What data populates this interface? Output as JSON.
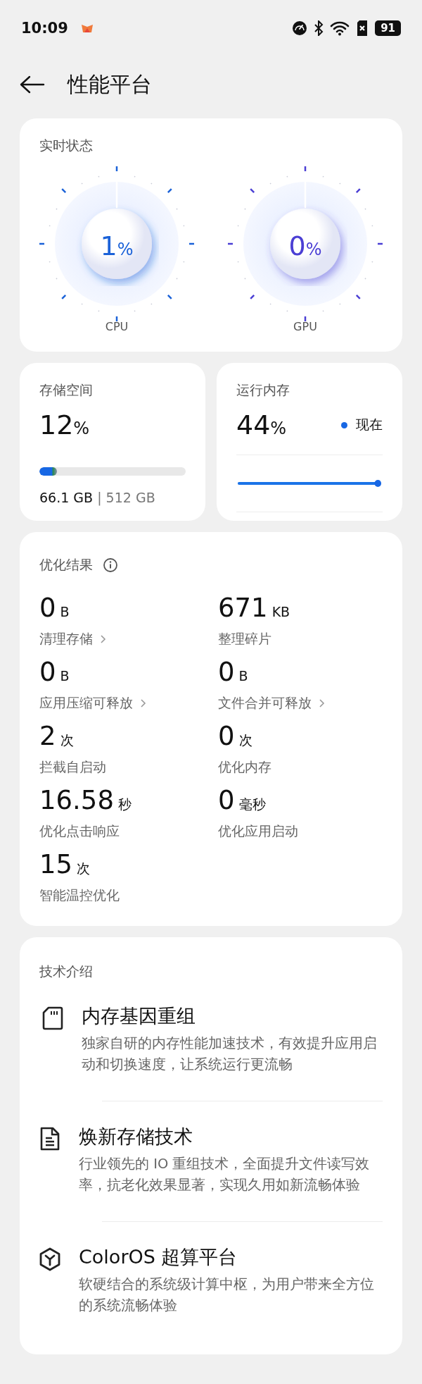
{
  "status_bar": {
    "time": "10:09",
    "battery": "91"
  },
  "header": {
    "title": "性能平台"
  },
  "realtime": {
    "title": "实时状态",
    "gauges": [
      {
        "label": "CPU",
        "value": "1",
        "unit": "%",
        "color": "#1b62d8"
      },
      {
        "label": "GPU",
        "value": "0",
        "unit": "%",
        "color": "#4b3fd4"
      }
    ]
  },
  "storage": {
    "title": "存储空间",
    "value": "12",
    "unit": "%",
    "level": 0.12,
    "used": "66.1 GB",
    "separator": "|",
    "total": "512 GB"
  },
  "memory": {
    "title": "运行内存",
    "value": "44",
    "unit": "%",
    "legend": "现在"
  },
  "optimization": {
    "title": "优化结果",
    "items": [
      {
        "value": "0",
        "unit": "B",
        "label": "清理存储",
        "chevron": true
      },
      {
        "value": "671",
        "unit": "KB",
        "label": "整理碎片",
        "chevron": false
      },
      {
        "value": "0",
        "unit": "B",
        "label": "应用压缩可释放",
        "chevron": true
      },
      {
        "value": "0",
        "unit": "B",
        "label": "文件合并可释放",
        "chevron": true
      },
      {
        "value": "2",
        "unit": "次",
        "label": "拦截自启动",
        "chevron": false
      },
      {
        "value": "0",
        "unit": "次",
        "label": "优化内存",
        "chevron": false
      },
      {
        "value": "16.58",
        "unit": "秒",
        "label": "优化点击响应",
        "chevron": false
      },
      {
        "value": "0",
        "unit": "毫秒",
        "label": "优化应用启动",
        "chevron": false
      },
      {
        "value": "15",
        "unit": "次",
        "label": "智能温控优化",
        "chevron": false
      }
    ]
  },
  "tech": {
    "title": "技术介绍",
    "items": [
      {
        "kind": "card",
        "title": "内存基因重组",
        "description": "独家自研的内存性能加速技术，有效提升应用启动和切换速度，让系统运行更流畅"
      },
      {
        "kind": "document",
        "title": "焕新存储技术",
        "description": "行业领先的 IO 重组技术，全面提升文件读写效率，抗老化效果显著，实现久用如新流畅体验"
      },
      {
        "kind": "cube",
        "title": "ColorOS 超算平台",
        "description": "软硬结合的系统级计算中枢，为用户带来全方位的系统流畅体验"
      }
    ]
  }
}
